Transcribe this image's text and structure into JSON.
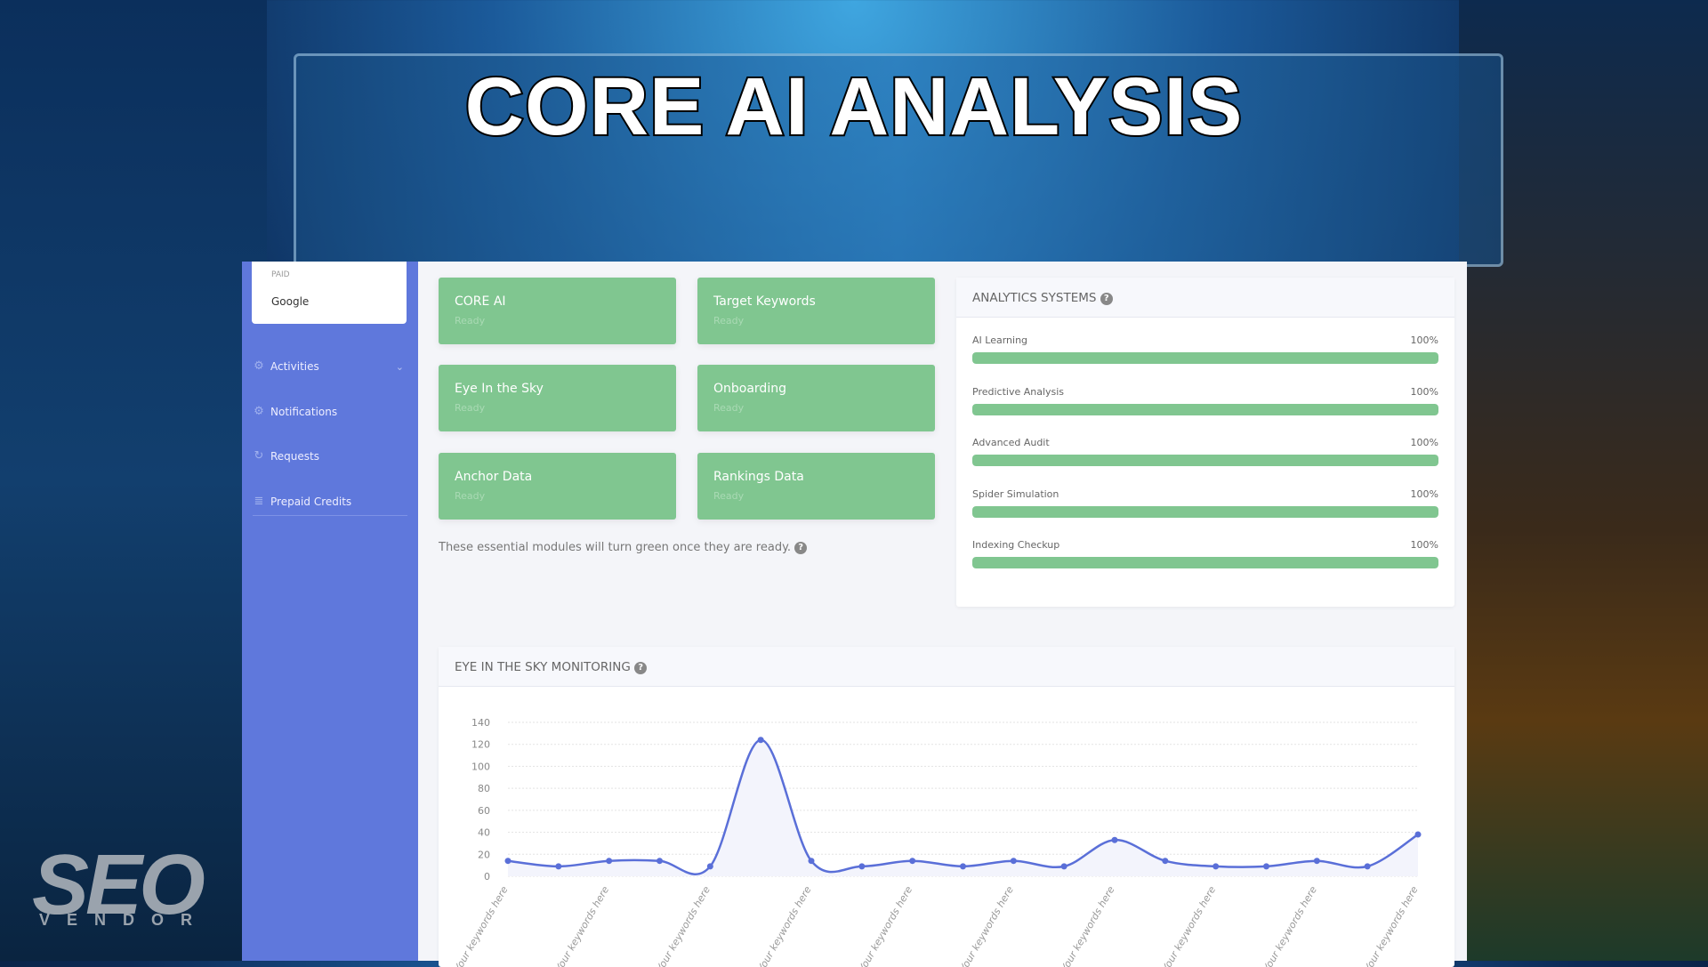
{
  "title": "CORE AI ANALYSIS",
  "logo": {
    "main": "SEO",
    "sub": "VENDOR"
  },
  "sidebar": {
    "account_label": "PAID",
    "account_value": "Google",
    "items": [
      {
        "label": "Activities",
        "icon": "gear-icon",
        "expandable": true
      },
      {
        "label": "Notifications",
        "icon": "gear-icon"
      },
      {
        "label": "Requests",
        "icon": "refresh-icon"
      },
      {
        "label": "Prepaid Credits",
        "icon": "coins-icon"
      }
    ]
  },
  "modules": [
    {
      "name": "CORE AI",
      "status": "Ready"
    },
    {
      "name": "Target Keywords",
      "status": "Ready"
    },
    {
      "name": "Eye In the Sky",
      "status": "Ready"
    },
    {
      "name": "Onboarding",
      "status": "Ready"
    },
    {
      "name": "Anchor Data",
      "status": "Ready"
    },
    {
      "name": "Rankings Data",
      "status": "Ready"
    }
  ],
  "modules_note": "These essential modules will turn green once they are ready.",
  "analytics": {
    "title": "ANALYTICS SYSTEMS",
    "items": [
      {
        "label": "AI Learning",
        "value": "100%",
        "progress": 100
      },
      {
        "label": "Predictive Analysis",
        "value": "100%",
        "progress": 100
      },
      {
        "label": "Advanced Audit",
        "value": "100%",
        "progress": 100
      },
      {
        "label": "Spider Simulation",
        "value": "100%",
        "progress": 100
      },
      {
        "label": "Indexing Checkup",
        "value": "100%",
        "progress": 100
      }
    ]
  },
  "colors": {
    "sidebar": "#5f78dc",
    "module_ready": "#80c690",
    "line": "#5a6fd8"
  },
  "chart_data": {
    "type": "area",
    "title": "EYE IN THE SKY MONITORING",
    "ylim": [
      0,
      140
    ],
    "yticks": [
      0,
      20,
      40,
      60,
      80,
      100,
      120,
      140
    ],
    "grid": true,
    "x_tick_label": "Your keywords here",
    "x_tick_every": 2,
    "values": [
      14,
      9,
      14,
      14,
      9,
      124,
      14,
      9,
      14,
      9,
      14,
      9,
      33,
      14,
      9,
      9,
      14,
      9,
      38
    ]
  }
}
